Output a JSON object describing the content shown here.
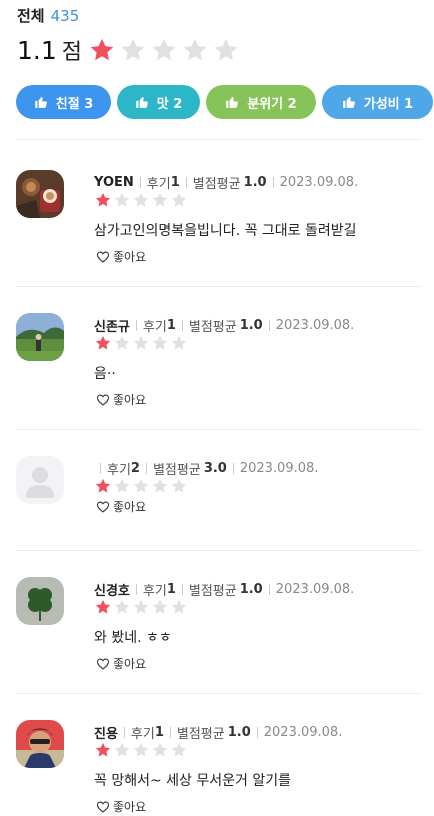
{
  "header": {
    "title": "전체",
    "count": "435"
  },
  "summary": {
    "score": "1.1",
    "unit": "점",
    "rating": 1.1,
    "max_stars": 5
  },
  "chips": [
    {
      "label": "친절 3",
      "color": "#3d95ef",
      "icon": "thumb-up-icon"
    },
    {
      "label": "맛 2",
      "color": "#2db5c8",
      "icon": "thumb-up-icon"
    },
    {
      "label": "분위기 2",
      "color": "#86c45a",
      "icon": "thumb-up-icon"
    },
    {
      "label": "가성비 1",
      "color": "#4fa7e8",
      "icon": "thumb-up-icon"
    }
  ],
  "colors": {
    "star_on": "#f2505e",
    "star_off": "#e1e1e1"
  },
  "reviews": [
    {
      "name": "YOEN",
      "reviews_label": "후기",
      "reviews": "1",
      "avg_label": "별점평균",
      "avg": "1.0",
      "date": "2023.09.08.",
      "rating": 1,
      "text": "삼가고인의명복을빕니다. 꼭 그대로 돌려받길",
      "like": "좋아요",
      "avatar": "food-photo"
    },
    {
      "name": "신존규",
      "reviews_label": "후기",
      "reviews": "1",
      "avg_label": "별점평균",
      "avg": "1.0",
      "date": "2023.09.08.",
      "rating": 1,
      "text": "음··",
      "like": "좋아요",
      "avatar": "golf-photo"
    },
    {
      "name": "",
      "reviews_label": "후기",
      "reviews": "2",
      "avg_label": "별점평균",
      "avg": "3.0",
      "date": "2023.09.08.",
      "rating": 1,
      "text": "",
      "like": "좋아요",
      "avatar": "default-avatar"
    },
    {
      "name": "신경호",
      "reviews_label": "후기",
      "reviews": "1",
      "avg_label": "별점평균",
      "avg": "1.0",
      "date": "2023.09.08.",
      "rating": 1,
      "text": "와 봤네. ㅎㅎ",
      "like": "좋아요",
      "avatar": "clover-photo"
    },
    {
      "name": "진용",
      "reviews_label": "후기",
      "reviews": "1",
      "avg_label": "별점평균",
      "avg": "1.0",
      "date": "2023.09.08.",
      "rating": 1,
      "text": "꼭 망해서~ 세상 무서운거 알기를",
      "like": "좋아요",
      "avatar": "person-photo"
    }
  ]
}
